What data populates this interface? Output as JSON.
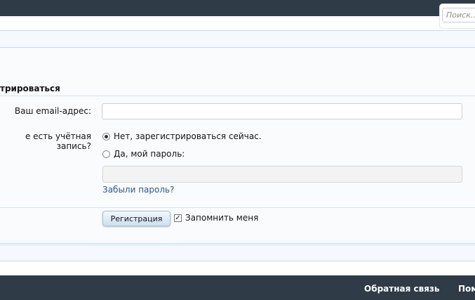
{
  "search": {
    "placeholder": "Поиск..."
  },
  "login": {
    "title": "трироваться",
    "email_label": "Ваш email-адрес:",
    "account_question": "е есть учётная запись?",
    "option_no": "Нет, зарегистрироваться сейчас.",
    "option_yes": "Да, мой пароль:",
    "forgot_link": "Забыли пароль?",
    "register_button": "Регистрация",
    "remember_label": "Запомнить меня"
  },
  "footer": {
    "links": [
      "Обратная связь",
      "Пом"
    ]
  }
}
